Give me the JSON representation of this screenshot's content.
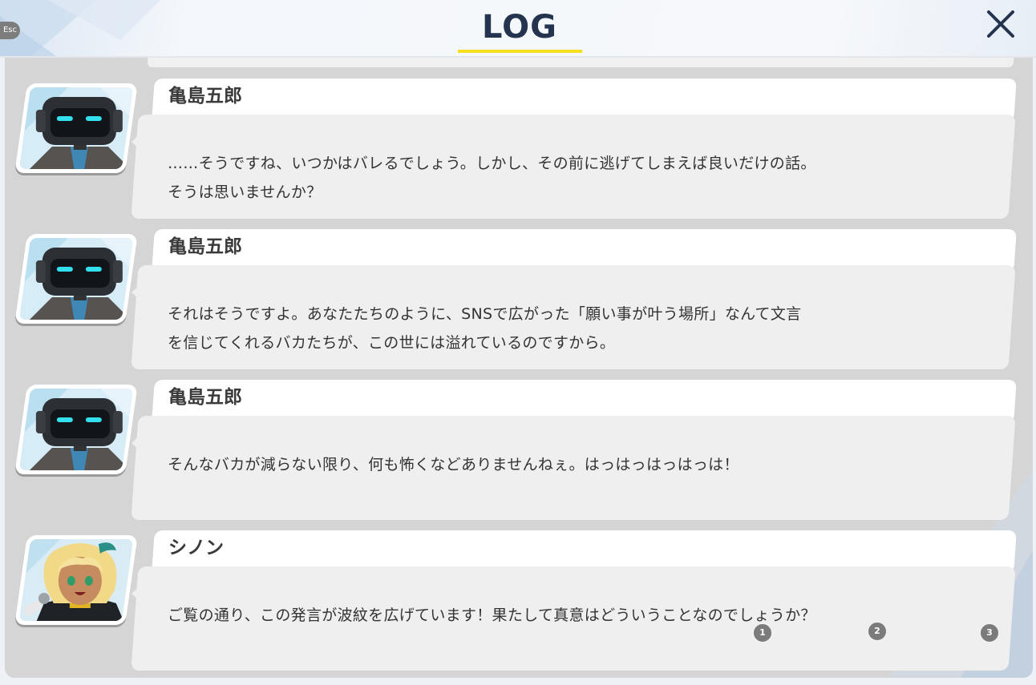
{
  "header": {
    "title": "LOG",
    "esc_label": "Esc",
    "close_icon": "close-x-icon",
    "underline_color": "#f5df1e",
    "title_color": "#24344f"
  },
  "entries": [
    {
      "speaker": "亀島五郎",
      "avatar": "robot-head-avatar",
      "lines": [
        "……そうですね、いつかはバレるでしょう。しかし、その前に逃げてしまえば良いだけの話。",
        "そうは思いませんか？"
      ]
    },
    {
      "speaker": "亀島五郎",
      "avatar": "robot-head-avatar",
      "lines": [
        "それはそうですよ。あなたたちのように、SNSで広がった「願い事が叶う場所」なんて文言",
        "を信じてくれるバカたちが、この世には溢れているのですから。"
      ]
    },
    {
      "speaker": "亀島五郎",
      "avatar": "robot-head-avatar",
      "lines": [
        "そんなバカが減らない限り、何も怖くなどありませんねぇ。はっはっはっはっは！",
        ""
      ]
    },
    {
      "speaker": "シノン",
      "avatar": "blonde-girl-avatar",
      "lines": [
        "ご覧の通り、この発言が波紋を広げています！果たして真意はどういうことなのでしょうか？",
        ""
      ]
    }
  ],
  "page_markers": [
    "1",
    "2",
    "3"
  ]
}
